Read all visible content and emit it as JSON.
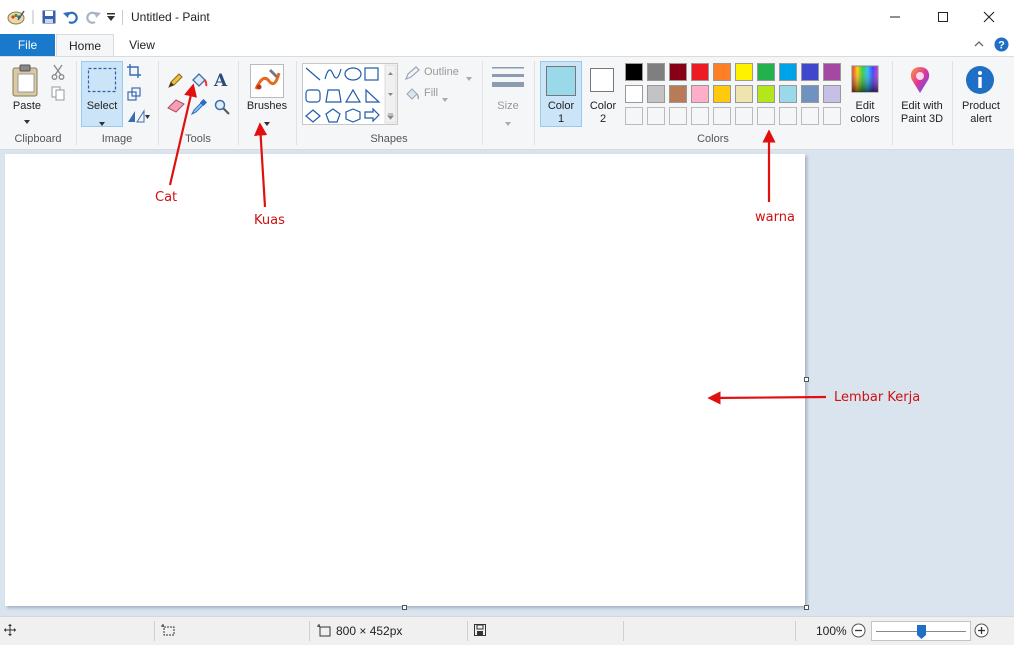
{
  "window": {
    "title": "Untitled - Paint"
  },
  "tabs": {
    "file": "File",
    "home": "Home",
    "view": "View"
  },
  "ribbon": {
    "clipboard": {
      "paste": "Paste",
      "group": "Clipboard"
    },
    "image": {
      "select": "Select",
      "group": "Image"
    },
    "tools": {
      "group": "Tools"
    },
    "brushes": {
      "label": "Brushes"
    },
    "shapes": {
      "outline": "Outline",
      "fill": "Fill",
      "group": "Shapes"
    },
    "size": {
      "label": "Size"
    },
    "colors": {
      "color1_line1": "Color",
      "color1_line2": "1",
      "color2_line1": "Color",
      "color2_line2": "2",
      "group": "Colors",
      "edit_line1": "Edit",
      "edit_line2": "colors",
      "color1_value": "#99d9ea",
      "color2_value": "#ffffff",
      "palette_row1": [
        "#000000",
        "#7f7f7f",
        "#880015",
        "#ed1c24",
        "#ff7f27",
        "#fff200",
        "#22b14c",
        "#00a2e8",
        "#3f48cc",
        "#a349a4"
      ],
      "palette_row2": [
        "#ffffff",
        "#c3c3c3",
        "#b97a57",
        "#ffaec9",
        "#ffc90e",
        "#efe4b0",
        "#b5e61d",
        "#99d9ea",
        "#7092be",
        "#c8bfe7"
      ]
    },
    "paint3d": {
      "line1": "Edit with",
      "line2": "Paint 3D"
    },
    "product_alert": {
      "line1": "Product",
      "line2": "alert"
    }
  },
  "statusbar": {
    "canvas_size": "800 × 452px",
    "zoom": "100%",
    "zoom_level": 0.5
  },
  "annotations": {
    "cat": "Cat",
    "kuas": "Kuas",
    "warna": "warna",
    "lembar_kerja": "Lembar Kerja"
  },
  "icons": [
    "paint-app-icon",
    "save-icon",
    "undo-icon",
    "redo-icon",
    "customize-icon",
    "minimize-icon",
    "maximize-icon",
    "close-icon",
    "collapse-ribbon-icon",
    "help-icon",
    "paste-icon",
    "cut-icon",
    "copy-icon",
    "select-icon",
    "crop-icon",
    "resize-icon",
    "rotate-icon",
    "pencil-icon",
    "fill-bucket-icon",
    "text-icon",
    "eraser-icon",
    "color-picker-icon",
    "magnifier-icon",
    "brushes-icon",
    "outline-icon",
    "fill-icon",
    "size-icon",
    "edit-colors-icon",
    "paint3d-icon",
    "info-icon",
    "move-icon",
    "selection-size-icon",
    "canvas-size-icon",
    "file-size-icon",
    "zoom-out-icon",
    "zoom-in-icon"
  ]
}
